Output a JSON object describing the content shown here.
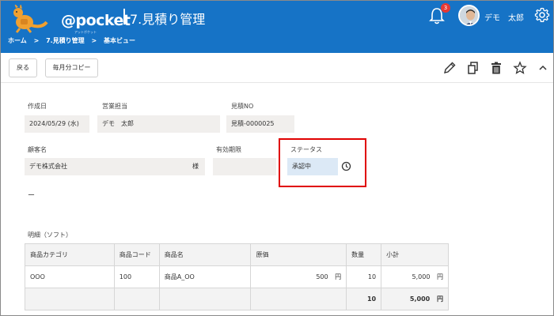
{
  "header": {
    "logo_text": "@pocket",
    "logo_sub": "アットポケット",
    "app_title": "7.見積り管理",
    "breadcrumb": [
      "ホーム",
      ">",
      "7.見積り管理",
      ">",
      "基本ビュー"
    ],
    "notification_count": "3",
    "user_name": "デモ　太郎",
    "colors": {
      "bar": "#1673c6",
      "badge": "#e53935"
    }
  },
  "toolbar": {
    "back_label": "戻る",
    "monthly_copy_label": "毎月分コピー",
    "icons": [
      "pencil-icon",
      "copy-icon",
      "trash-icon",
      "star-icon",
      "chevron-up-icon"
    ]
  },
  "form": {
    "created_label": "作成日",
    "created_value": "2024/05/29 (水)",
    "sales_label": "営業担当",
    "sales_value": "デモ　太郎",
    "quote_no_label": "見積NO",
    "quote_no_value": "見積-0000025",
    "customer_label": "顧客名",
    "customer_value": "デモ株式会社",
    "customer_suffix": "様",
    "expiry_label": "有効期限",
    "expiry_value": "",
    "status_label": "ステータス",
    "status_value": "承認中",
    "dash": "ー"
  },
  "table": {
    "section_title": "明細（ソフト）",
    "headers": [
      "商品カテゴリ",
      "商品コード",
      "商品名",
      "原価",
      "数量",
      "小計"
    ],
    "rows": [
      {
        "category": "OOO",
        "code": "100",
        "name": "商品A_OO",
        "cost": "500",
        "cost_unit": "円",
        "qty": "10",
        "subtotal": "5,000",
        "subtotal_unit": "円"
      }
    ],
    "footer": {
      "qty": "10",
      "subtotal": "5,000",
      "subtotal_unit": "円"
    }
  }
}
